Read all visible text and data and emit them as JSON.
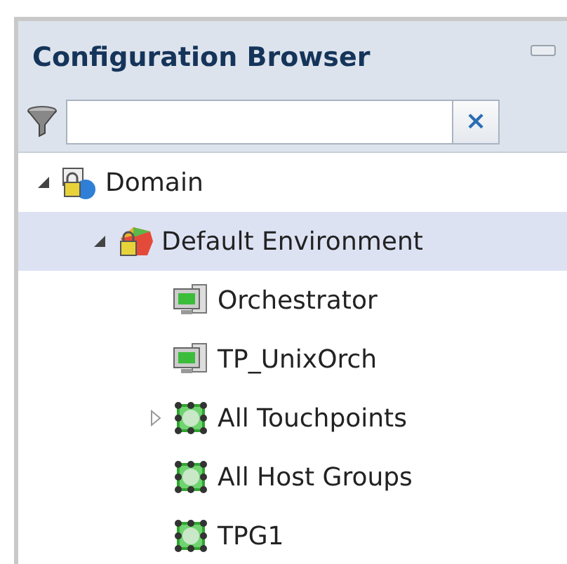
{
  "panel": {
    "title": "Configuration Browser"
  },
  "filter": {
    "clear_button": "×"
  },
  "tree": [
    {
      "label": "Domain",
      "kind": "domain",
      "expanded": true,
      "selected": false,
      "children": [
        {
          "label": "Default Environment",
          "kind": "environment",
          "expanded": true,
          "selected": true,
          "children": [
            {
              "label": "Orchestrator",
              "kind": "server",
              "selected": false
            },
            {
              "label": "TP_UnixOrch",
              "kind": "server",
              "selected": false
            },
            {
              "label": "All Touchpoints",
              "kind": "group",
              "expanded": false,
              "selected": false
            },
            {
              "label": "All Host Groups",
              "kind": "group",
              "selected": false
            },
            {
              "label": "TPG1",
              "kind": "group",
              "selected": false
            }
          ]
        }
      ]
    }
  ]
}
